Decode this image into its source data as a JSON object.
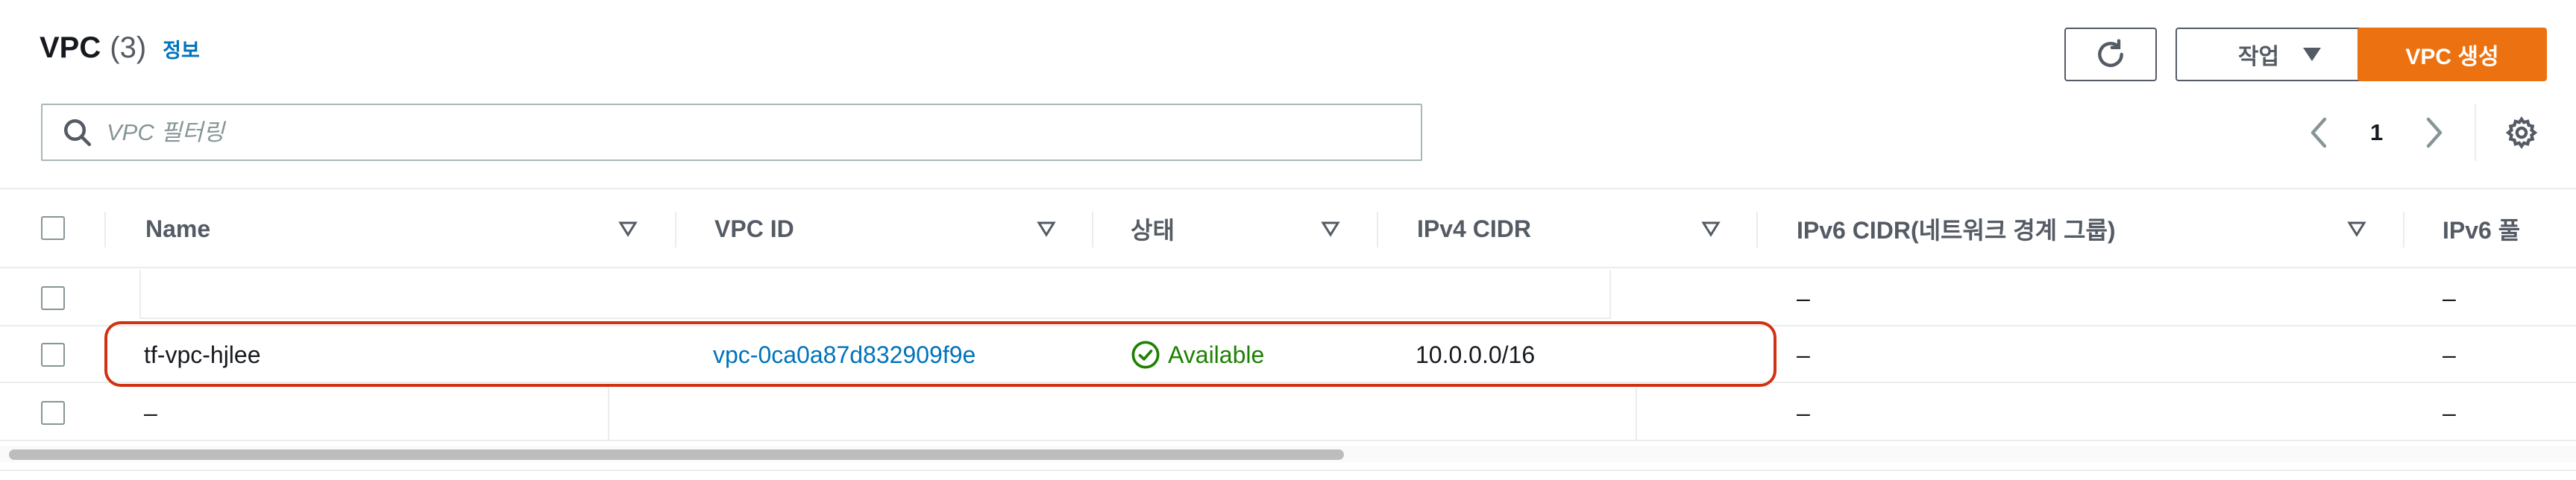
{
  "header": {
    "title": "VPC",
    "count": "(3)",
    "info_label": "정보",
    "actions_label": "작업",
    "create_label": "VPC 생성"
  },
  "filter": {
    "placeholder": "VPC 필터링",
    "value": ""
  },
  "pagination": {
    "current_page": "1"
  },
  "table": {
    "columns": [
      "Name",
      "VPC ID",
      "상태",
      "IPv4 CIDR",
      "IPv6 CIDR(네트워크 경계 그룹)",
      "IPv6 풀"
    ],
    "rows": [
      {
        "name": "",
        "vpc_id": "",
        "status": "",
        "ipv4": "",
        "ipv6_cidr": "–",
        "ipv6_pool": "–"
      },
      {
        "name": "tf-vpc-hjlee",
        "vpc_id": "vpc-0ca0a87d832909f9e",
        "status": "Available",
        "ipv4": "10.0.0.0/16",
        "ipv6_cidr": "–",
        "ipv6_pool": "–"
      },
      {
        "name": "–",
        "vpc_id": "",
        "status": "",
        "ipv4": "",
        "ipv6_cidr": "–",
        "ipv6_pool": "–"
      }
    ]
  },
  "colors": {
    "accent_orange": "#ec7211",
    "link_blue": "#0073bb",
    "status_green": "#1d8102",
    "highlight_red": "#d13212"
  }
}
